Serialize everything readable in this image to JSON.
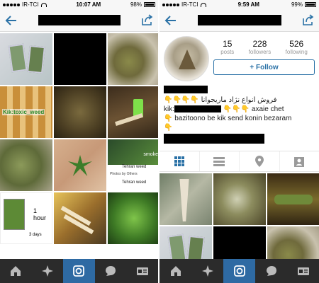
{
  "left": {
    "status": {
      "carrier": "IR-TCI",
      "time": "10:07 AM",
      "battery": "98%"
    },
    "grid_cells": [
      {
        "label": ""
      },
      {
        "label": ""
      },
      {
        "label": ""
      },
      {
        "label": "Kik:toxic_weed"
      },
      {
        "label": ""
      },
      {
        "label": ""
      },
      {
        "label": ""
      },
      {
        "label": ""
      },
      {
        "label": "Tehran weed"
      },
      {
        "label": "1 hour"
      },
      {
        "label": ""
      },
      {
        "label": ""
      }
    ],
    "grid_small_labels": {
      "three_days": "3 days",
      "smoke": "smoke",
      "photos_by_others": "Photos by Others",
      "tehran_weed_2": "Tehran weed"
    }
  },
  "right": {
    "status": {
      "carrier": "IR-TCI",
      "time": "9:59 AM",
      "battery": "99%"
    },
    "profile": {
      "posts_count": "15",
      "posts_label": "posts",
      "followers_count": "228",
      "followers_label": "followers",
      "following_count": "526",
      "following_label": "following",
      "follow_label": "+ Follow"
    },
    "bio": {
      "line1": "فروش انواع نژاد ماریجوانا",
      "kik_prefix": "kik:",
      "axaie": "axaie chet",
      "line3": "bazitoono be kik send konin bezaram"
    }
  },
  "colors": {
    "accent": "#2a71a6",
    "tabbar": "#2b2b2b",
    "tab_active": "#2e6aa3"
  }
}
